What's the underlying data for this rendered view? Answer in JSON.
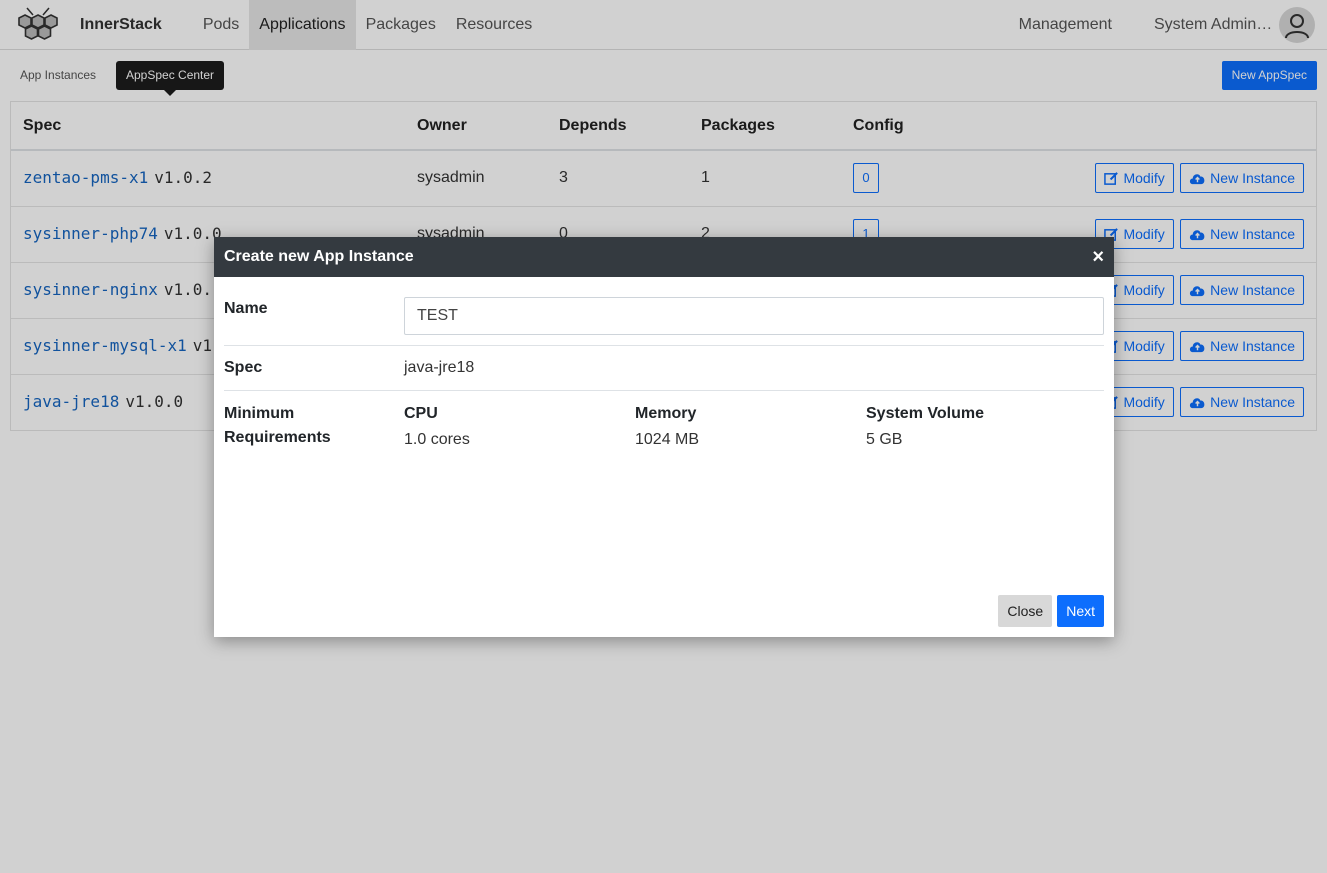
{
  "navbar": {
    "brand": "InnerStack",
    "items": [
      {
        "label": "Pods",
        "active": false
      },
      {
        "label": "Applications",
        "active": true
      },
      {
        "label": "Packages",
        "active": false
      },
      {
        "label": "Resources",
        "active": false
      }
    ],
    "management": "Management",
    "user": "System Administrator"
  },
  "subbar": {
    "app_instances": "App Instances",
    "tooltip": "AppSpec Center",
    "new_appspec": "New AppSpec"
  },
  "table": {
    "headers": [
      "Spec",
      "Owner",
      "Depends",
      "Packages",
      "Config"
    ],
    "rows": [
      {
        "name": "zentao-pms-x1",
        "version": "v1.0.2",
        "owner": "sysadmin",
        "depends": "3",
        "packages": "1",
        "config": "0"
      },
      {
        "name": "sysinner-php74",
        "version": "v1.0.0",
        "owner": "sysadmin",
        "depends": "0",
        "packages": "2",
        "config": "1"
      },
      {
        "name": "sysinner-nginx",
        "version": "v1.0.",
        "owner": "",
        "depends": "",
        "packages": "",
        "config": ""
      },
      {
        "name": "sysinner-mysql-x1",
        "version": "v1",
        "owner": "",
        "depends": "",
        "packages": "",
        "config": ""
      },
      {
        "name": "java-jre18",
        "version": "v1.0.0",
        "owner": "",
        "depends": "",
        "packages": "",
        "config": ""
      }
    ],
    "modify_label": "Modify",
    "new_instance_label": "New Instance"
  },
  "modal": {
    "title": "Create new App Instance",
    "close_symbol": "×",
    "name_label": "Name",
    "name_value": "TEST",
    "spec_label": "Spec",
    "spec_value": "java-jre18",
    "min_req_label": "Minimum Requirements",
    "requirements": [
      {
        "label": "CPU",
        "value": "1.0 cores"
      },
      {
        "label": "Memory",
        "value": "1024 MB"
      },
      {
        "label": "System Volume",
        "value": "5 GB"
      }
    ],
    "close_button": "Close",
    "next_button": "Next"
  },
  "colors": {
    "primary": "#0d6efd",
    "modal_header": "#343a40",
    "spec_link": "#1565c0"
  }
}
